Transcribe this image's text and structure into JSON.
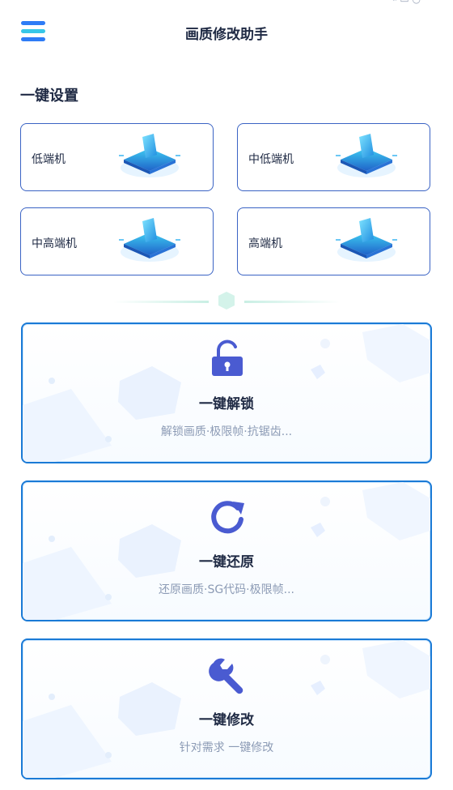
{
  "header": {
    "title": "画质修改助手",
    "status_fragment": "⌁ ▭ ◔"
  },
  "section": {
    "title": "一键设置"
  },
  "tiers": [
    {
      "label": "低端机"
    },
    {
      "label": "中低端机"
    },
    {
      "label": "中高端机"
    },
    {
      "label": "高端机"
    }
  ],
  "actions": [
    {
      "title": "一键解锁",
      "desc": "解锁画质·极限帧·抗锯齿...",
      "icon": "unlock-icon"
    },
    {
      "title": "一键还原",
      "desc": "还原画质·SG代码·极限帧...",
      "icon": "refresh-icon"
    },
    {
      "title": "一键修改",
      "desc": "针对需求 一键修改",
      "icon": "wrench-icon"
    }
  ],
  "colors": {
    "primary": "#3a63c4",
    "accent_blue": "#2e7cf6",
    "accent_cyan": "#37c7e8",
    "icon_indigo": "#4a5bd1",
    "text_dark": "#1f2a44",
    "text_muted": "#8c9bb5"
  }
}
